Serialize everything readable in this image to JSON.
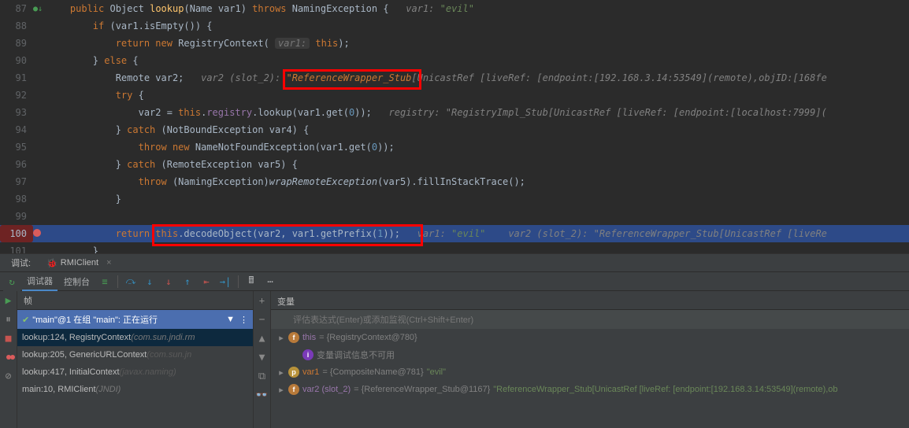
{
  "editor": {
    "lines": [
      {
        "num": "87",
        "html": "    <span class='kw'>public</span> <span class='cls'>Object</span> <span class='method'>lookup</span>(<span class='cls'>Name</span> var1) <span class='kw'>throws</span> <span class='cls'>NamingException</span> {   <span class='comment'>var1: </span><span class='comment-val'>\"evil\"</span>"
      },
      {
        "num": "88",
        "html": "        <span class='kw'>if</span> (var1.isEmpty()) {"
      },
      {
        "num": "89",
        "html": "            <span class='kw'>return new</span> <span class='cls'>RegistryContext</span>( <span class='param-hint'>var1:</span> <span class='kw'>this</span>);"
      },
      {
        "num": "90",
        "html": "        } <span class='kw'>else</span> {"
      },
      {
        "num": "91",
        "html": "            <span class='cls'>Remote</span> var2;   <span class='comment'>var2 (slot_2): </span><span style='position:relative;'><span class='red-box' style='position:absolute;left:-4px;top:-4px;width:176px;height:26px;pointer-events:none;'></span><span class='comment' style='color:#cc7832;'>\"ReferenceWrapper_Stub</span></span><span class='comment'>[UnicastRef [liveRef: [endpoint:[192.168.3.14:53549](remote),objID:[168fe</span>"
      },
      {
        "num": "92",
        "html": "            <span class='kw'>try</span> {"
      },
      {
        "num": "93",
        "html": "                var2 = <span class='kw'>this</span>.<span class='field'>registry</span>.lookup(var1.get(<span class='num'>0</span>));   <span class='comment'>registry: \"RegistryImpl_Stub[UnicastRef [liveRef: [endpoint:[localhost:7999](</span>"
      },
      {
        "num": "94",
        "html": "            } <span class='kw'>catch</span> (<span class='cls'>NotBoundException</span> var4) {"
      },
      {
        "num": "95",
        "html": "                <span class='kw'>throw new</span> <span class='cls'>NameNotFoundException</span>(var1.get(<span class='num'>0</span>));"
      },
      {
        "num": "96",
        "html": "            } <span class='kw'>catch</span> (<span class='cls'>RemoteException</span> var5) {"
      },
      {
        "num": "97",
        "html": "                <span class='kw'>throw</span> (<span class='cls'>NamingException</span>)<span style='font-style:italic'>wrapRemoteException</span>(var5).fillInStackTrace();"
      },
      {
        "num": "98",
        "html": "            }"
      },
      {
        "num": "99",
        "html": ""
      },
      {
        "num": "100",
        "hl": true,
        "html": "            <span class='kw'>return</span> <span style='position:relative;'><span class='red-box' style='position:absolute;left:-4px;top:-5px;width:344px;height:28px;pointer-events:none;'></span><span class='kw'>this</span>.decodeObject(var2, var1.getPrefix(<span class='num'>1</span>));</span>   <span class='comment'>var1: </span><span class='comment-val'>\"evil\"</span>    <span class='comment'>var2 (slot_2): \"ReferenceWrapper_Stub[UnicastRef [liveRe</span>"
      },
      {
        "num": "101",
        "html": "        }"
      }
    ]
  },
  "tabs": {
    "debug_label": "调试:",
    "client": "RMIClient"
  },
  "debug_tb": {
    "debugger": "调试器",
    "console": "控制台"
  },
  "frames": {
    "head": "帧",
    "thread": "\"main\"@1 在组 \"main\": 正在运行",
    "rows": [
      {
        "m": "lookup:124, RegistryContext",
        "p": "(com.sun.jndi.rm",
        "sel": true,
        "cls": "frame-dim"
      },
      {
        "m": "lookup:205, GenericURLContext",
        "p": "(com.sun.jn",
        "cls": "frame-dark"
      },
      {
        "m": "lookup:417, InitialContext",
        "p": "(javax.naming)",
        "cls": "frame-dark"
      },
      {
        "m": "main:10, RMIClient",
        "p": "(JNDI)",
        "cls": "frame-dim"
      }
    ]
  },
  "vars": {
    "head": "变量",
    "watch_ph": "评估表达式(Enter)或添加监视(Ctrl+Shift+Enter)",
    "rows": [
      {
        "toggle": "▸",
        "icon": "f",
        "iconcls": "vi-f",
        "name": "this",
        "val": " = {RegistryContext@780}"
      },
      {
        "toggle": " ",
        "icon": "i",
        "iconcls": "vi-i",
        "noname": true,
        "val": "变量调试信息不可用",
        "indent": true
      },
      {
        "toggle": "▸",
        "icon": "p",
        "iconcls": "vi-p",
        "name": "var1",
        "val": " = {CompositeName@781} ",
        "str": "\"evil\""
      },
      {
        "toggle": "▸",
        "icon": "f",
        "iconcls": "vi-f",
        "name": "var2 (slot_2)",
        "val": " = {ReferenceWrapper_Stub@1167} ",
        "str": "\"ReferenceWrapper_Stub[UnicastRef [liveRef: [endpoint:[192.168.3.14:53549](remote),ob"
      }
    ]
  }
}
